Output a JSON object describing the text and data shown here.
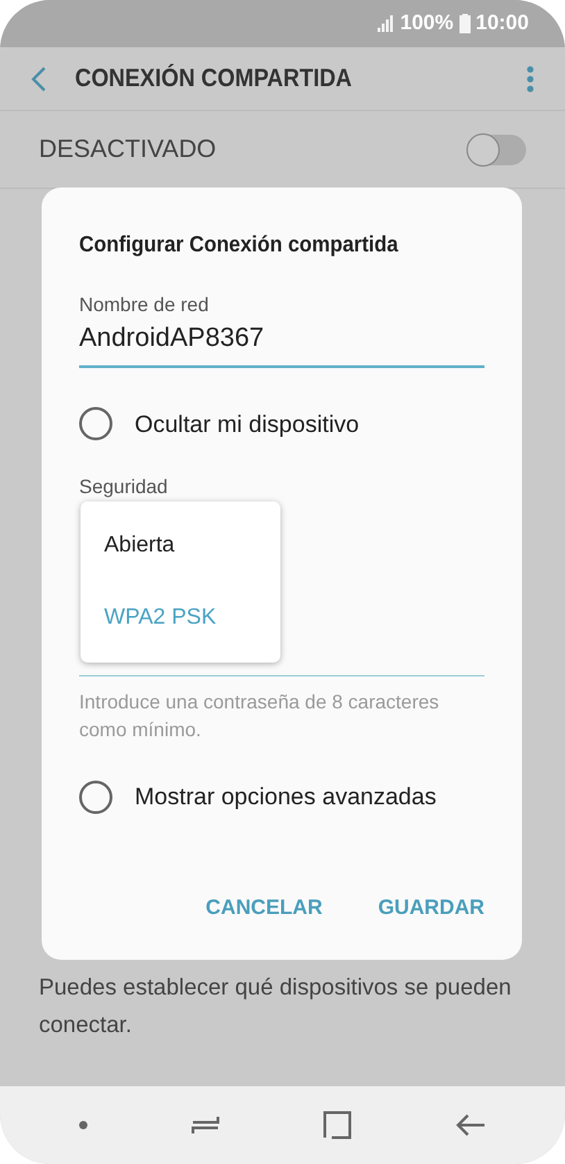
{
  "status_bar": {
    "battery": "100%",
    "time": "10:00"
  },
  "app_bar": {
    "title": "CONEXIÓN COMPARTIDA"
  },
  "hotspot": {
    "label": "DESACTIVADO",
    "on": false
  },
  "dialog": {
    "title": "Configurar Conexión compartida",
    "network_name": {
      "label": "Nombre de red",
      "value": "AndroidAP8367"
    },
    "hide_device": {
      "label": "Ocultar mi dispositivo",
      "checked": false
    },
    "security": {
      "label": "Seguridad",
      "options": [
        {
          "label": "Abierta",
          "selected": false
        },
        {
          "label": "WPA2 PSK",
          "selected": true
        }
      ]
    },
    "password": {
      "hint": "Introduce una contraseña de 8 caracteres como mínimo."
    },
    "advanced": {
      "label": "Mostrar opciones avanzadas",
      "checked": false
    },
    "buttons": [
      "CANCELAR",
      "GUARDAR"
    ]
  },
  "footer_text": "Puedes establecer qué dispositivos se pueden conectar."
}
